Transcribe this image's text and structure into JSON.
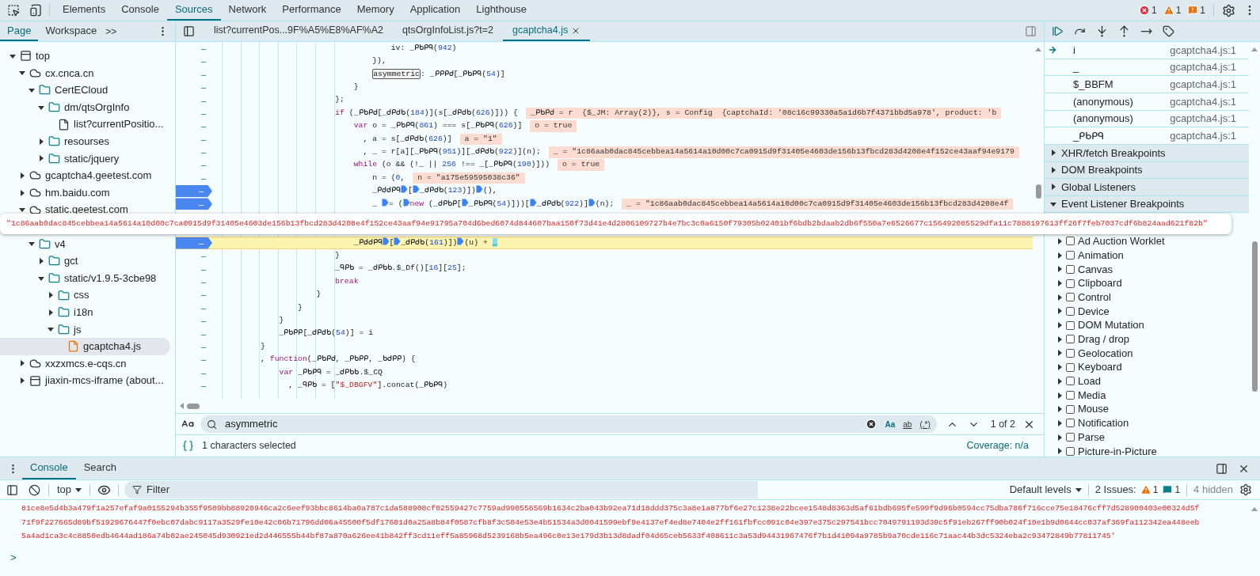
{
  "main_tabs": [
    {
      "label": "Elements",
      "selected": false
    },
    {
      "label": "Console",
      "selected": false
    },
    {
      "label": "Sources",
      "selected": true
    },
    {
      "label": "Network",
      "selected": false
    },
    {
      "label": "Performance",
      "selected": false
    },
    {
      "label": "Memory",
      "selected": false
    },
    {
      "label": "Application",
      "selected": false
    },
    {
      "label": "Lighthouse",
      "selected": false
    }
  ],
  "counters": [
    {
      "kind": "error",
      "count": "1"
    },
    {
      "kind": "warning",
      "count": "1"
    },
    {
      "kind": "issue",
      "count": "1"
    }
  ],
  "navigator": {
    "tabs": [
      {
        "label": "Page",
        "selected": true
      },
      {
        "label": "Workspace",
        "selected": false
      }
    ],
    "more": ">>",
    "tree": [
      {
        "label": "top",
        "kind": "frame",
        "expanded": true,
        "selected": false,
        "children": [
          {
            "label": "cx.cnca.cn",
            "kind": "domain",
            "expanded": true,
            "selected": false,
            "children": [
              {
                "label": "CertECloud",
                "kind": "folder",
                "expanded": true,
                "selected": false,
                "children": [
                  {
                    "label": "dm/qtsOrgInfo",
                    "kind": "folder",
                    "expanded": true,
                    "selected": false,
                    "children": [
                      {
                        "label": "list?currentPositio...",
                        "kind": "file",
                        "selected": false
                      }
                    ]
                  },
                  {
                    "label": "resourses",
                    "kind": "folder",
                    "expanded": false,
                    "selected": false
                  },
                  {
                    "label": "static/jquery",
                    "kind": "folder",
                    "expanded": false,
                    "selected": false
                  }
                ]
              }
            ]
          },
          {
            "label": "gcaptcha4.geetest.com",
            "kind": "domain",
            "expanded": false,
            "selected": false
          },
          {
            "label": "hm.baidu.com",
            "kind": "domain",
            "expanded": false,
            "selected": false
          },
          {
            "label": "static.geetest.com",
            "kind": "domain",
            "expanded": true,
            "selected": false,
            "children": [
              {
                "kind": "covered"
              },
              {
                "label": "v4",
                "kind": "folder",
                "expanded": true,
                "selected": false,
                "children": [
                  {
                    "label": "gct",
                    "kind": "folder",
                    "expanded": false,
                    "selected": false
                  },
                  {
                    "label": "static/v1.9.5-3cbe98",
                    "kind": "folder",
                    "expanded": true,
                    "selected": false,
                    "children": [
                      {
                        "label": "css",
                        "kind": "folder",
                        "expanded": false,
                        "selected": false
                      },
                      {
                        "label": "i18n",
                        "kind": "folder",
                        "expanded": false,
                        "selected": false
                      },
                      {
                        "label": "js",
                        "kind": "folder",
                        "expanded": true,
                        "selected": false,
                        "children": [
                          {
                            "label": "gcaptcha4.js",
                            "kind": "script",
                            "selected": true
                          }
                        ]
                      }
                    ]
                  }
                ]
              }
            ]
          },
          {
            "label": "xxzxmcs.e-cqs.cn",
            "kind": "domain",
            "expanded": false,
            "selected": false
          },
          {
            "label": "jiaxin-mcs-iframe (about...",
            "kind": "frame",
            "expanded": false,
            "selected": false
          }
        ]
      }
    ]
  },
  "editor_tabs": [
    {
      "label": "list?currentPos...9F%A5%E8%AF%A2",
      "selected": false
    },
    {
      "label": "qtsOrgInfoList.js?t=2",
      "selected": false
    },
    {
      "label": "gcaptcha4.js",
      "selected": true
    }
  ],
  "code_lines": [
    {
      "gutter": "–",
      "breakpoint": false,
      "current": false,
      "tokens": [
        {
          "kind": "p",
          "text": "                                    iv: _ᑭᑲᑭᑫ("
        },
        {
          "kind": "n",
          "text": "942"
        },
        {
          "kind": "p",
          "text": ")"
        }
      ]
    },
    {
      "gutter": "–",
      "breakpoint": false,
      "current": false,
      "tokens": [
        {
          "kind": "p",
          "text": "                                }),"
        }
      ]
    },
    {
      "gutter": "–",
      "breakpoint": false,
      "current": false,
      "tokens": [
        {
          "kind": "m",
          "text": "                                asymmetric"
        },
        {
          "kind": "p",
          "text": ": _ᑭᑭᑭᑯ[_ᑭᑲᑭᑫ("
        },
        {
          "kind": "n",
          "text": "54"
        },
        {
          "kind": "p",
          "text": ")]"
        }
      ]
    },
    {
      "gutter": "–",
      "breakpoint": false,
      "current": false,
      "tokens": [
        {
          "kind": "p",
          "text": "                            }"
        }
      ]
    },
    {
      "gutter": "–",
      "breakpoint": false,
      "current": false,
      "tokens": [
        {
          "kind": "p",
          "text": "                        };"
        }
      ]
    },
    {
      "gutter": "–",
      "breakpoint": false,
      "current": false,
      "tokens": [
        {
          "kind": "k",
          "text": "                        if"
        },
        {
          "kind": "p",
          "text": " (_ᑭᑲᑭᑯ[_ᑯᑭᑯᑲ("
        },
        {
          "kind": "n",
          "text": "184"
        },
        {
          "kind": "p",
          "text": ")](s[_ᑯᑭᑯᑲ("
        },
        {
          "kind": "n",
          "text": "626"
        },
        {
          "kind": "p",
          "text": ")])) {"
        }
      ],
      "value": "_ᑭᑲᑭᑯ = r  {$_JM: Array(2)}, s = Config  {captchaId: '08c16c99330a5a1d6b7f4371bbd5a978', product: 'b"
    },
    {
      "gutter": "–",
      "breakpoint": false,
      "current": false,
      "tokens": [
        {
          "kind": "k",
          "text": "                            var"
        },
        {
          "kind": "p",
          "text": " o = _ᑭᑲᑭᑫ("
        },
        {
          "kind": "n",
          "text": "861"
        },
        {
          "kind": "p",
          "text": ") === s[_ᑭᑲᑭᑫ("
        },
        {
          "kind": "n",
          "text": "626"
        },
        {
          "kind": "p",
          "text": ")]"
        }
      ],
      "value": "o = true"
    },
    {
      "gutter": "–",
      "breakpoint": false,
      "current": false,
      "tokens": [
        {
          "kind": "p",
          "text": "                              , a = s[_ᑯᑭᑯᑲ("
        },
        {
          "kind": "n",
          "text": "626"
        },
        {
          "kind": "p",
          "text": ")]"
        }
      ],
      "value": "a = \"1\""
    },
    {
      "gutter": "–",
      "breakpoint": false,
      "current": false,
      "tokens": [
        {
          "kind": "p",
          "text": "                              , _ = r[a][_ᑭᑲᑭᑫ("
        },
        {
          "kind": "n",
          "text": "951"
        },
        {
          "kind": "p",
          "text": ")][_ᑯᑭᑯᑲ("
        },
        {
          "kind": "n",
          "text": "922"
        },
        {
          "kind": "p",
          "text": ")](n);"
        }
      ],
      "value": "_ = \"1c86aab0dac845cebbea14a5614a10d00c7ca0915d9f31405e4603de156b13fbcd283d4208e4f152ce43aaf94e9179"
    },
    {
      "gutter": "–",
      "breakpoint": false,
      "current": false,
      "tokens": [
        {
          "kind": "k",
          "text": "                            while"
        },
        {
          "kind": "p",
          "text": " (o && (!_ || "
        },
        {
          "kind": "n",
          "text": "256"
        },
        {
          "kind": "p",
          "text": " !== _[_ᑭᑲᑭᑫ("
        },
        {
          "kind": "n",
          "text": "190"
        },
        {
          "kind": "p",
          "text": ")]))"
        }
      ],
      "value": "o = true"
    },
    {
      "gutter": "–",
      "breakpoint": false,
      "current": false,
      "tokens": [
        {
          "kind": "p",
          "text": "                                n = ("
        },
        {
          "kind": "n",
          "text": "0"
        },
        {
          "kind": "p",
          "text": ","
        }
      ],
      "value": "n = \"a175e59595038c36\""
    },
    {
      "gutter": "–",
      "breakpoint": true,
      "current": false,
      "tokens": [
        {
          "kind": "p",
          "text": "                                _ᑭᑯᑯᑭᑫ"
        },
        {
          "kind": "b"
        },
        {
          "kind": "p",
          "text": "["
        },
        {
          "kind": "b"
        },
        {
          "kind": "p",
          "text": "_ᑯᑭᑯᑲ("
        },
        {
          "kind": "n",
          "text": "123"
        },
        {
          "kind": "p",
          "text": ")])"
        },
        {
          "kind": "b"
        },
        {
          "kind": "p",
          "text": "(),"
        }
      ]
    },
    {
      "gutter": "–",
      "breakpoint": true,
      "current": false,
      "tokens": [
        {
          "kind": "p",
          "text": "                                _ "
        },
        {
          "kind": "b"
        },
        {
          "kind": "p",
          "text": "= ("
        },
        {
          "kind": "b"
        },
        {
          "kind": "k",
          "text": "new"
        },
        {
          "kind": "p",
          "text": " (_ᑯᑭᑲᑭ["
        },
        {
          "kind": "b"
        },
        {
          "kind": "p",
          "text": "_ᑭᑲᑭᑫ("
        },
        {
          "kind": "n",
          "text": "54"
        },
        {
          "kind": "p",
          "text": ")]))["
        },
        {
          "kind": "b"
        },
        {
          "kind": "p",
          "text": "_ᑯᑭᑯᑲ("
        },
        {
          "kind": "n",
          "text": "922"
        },
        {
          "kind": "p",
          "text": ")]"
        },
        {
          "kind": "b"
        },
        {
          "kind": "p",
          "text": "(n);"
        }
      ],
      "value": "_ = \"1c86aab0dac845cebbea14a5614a10d00c7ca0915d9f31405e4603de156b13fbcd283d4208e4f"
    },
    {
      "kind": "covered"
    },
    {
      "kind": "covered"
    },
    {
      "gutter": "–",
      "breakpoint": true,
      "current": true,
      "tokens": [
        {
          "kind": "p",
          "text": "                            _ᑭᑯᑯᑭᑫ"
        },
        {
          "kind": "b"
        },
        {
          "kind": "p",
          "text": "["
        },
        {
          "kind": "b"
        },
        {
          "kind": "p",
          "text": "_ᑯᑭᑯᑲ("
        },
        {
          "kind": "n",
          "text": "161"
        },
        {
          "kind": "p",
          "text": ")])"
        },
        {
          "kind": "b"
        },
        {
          "kind": "p",
          "text": "(u) + "
        },
        {
          "kind": "c",
          "text": "_"
        }
      ]
    },
    {
      "gutter": "–",
      "breakpoint": false,
      "current": false,
      "tokens": [
        {
          "kind": "p",
          "text": "                        }"
        }
      ]
    },
    {
      "gutter": "–",
      "breakpoint": false,
      "current": false,
      "tokens": [
        {
          "kind": "p",
          "text": "                        _ᑫᑭᑲ = _ᑯᑭᑲᑲ.$_Df()["
        },
        {
          "kind": "n",
          "text": "16"
        },
        {
          "kind": "p",
          "text": "]["
        },
        {
          "kind": "n",
          "text": "25"
        },
        {
          "kind": "p",
          "text": "];"
        }
      ]
    },
    {
      "gutter": "–",
      "breakpoint": false,
      "current": false,
      "tokens": [
        {
          "kind": "k",
          "text": "                        break"
        }
      ]
    },
    {
      "gutter": "–",
      "breakpoint": false,
      "current": false,
      "tokens": [
        {
          "kind": "p",
          "text": "                    }"
        }
      ]
    },
    {
      "gutter": "–",
      "breakpoint": false,
      "current": false,
      "tokens": [
        {
          "kind": "p",
          "text": "                }"
        }
      ]
    },
    {
      "gutter": "–",
      "breakpoint": false,
      "current": false,
      "tokens": [
        {
          "kind": "p",
          "text": "            }"
        }
      ]
    },
    {
      "gutter": "–",
      "breakpoint": false,
      "current": false,
      "tokens": [
        {
          "kind": "p",
          "text": "            _ᑭᑲᑭᑭ[_ᑯᑭᑯᑲ("
        },
        {
          "kind": "n",
          "text": "54"
        },
        {
          "kind": "p",
          "text": ")] = i"
        }
      ]
    },
    {
      "gutter": "–",
      "breakpoint": false,
      "current": false,
      "tokens": [
        {
          "kind": "p",
          "text": "        }"
        }
      ]
    },
    {
      "gutter": "–",
      "breakpoint": false,
      "current": false,
      "tokens": [
        {
          "kind": "p",
          "text": "        , "
        },
        {
          "kind": "k",
          "text": "function"
        },
        {
          "kind": "p",
          "text": "(_ᑭᑲᑭᑯ, _ᑭᑲᑭᑭ, _ᑲᑯᑭᑭ) {"
        }
      ]
    },
    {
      "gutter": "–",
      "breakpoint": false,
      "current": false,
      "tokens": [
        {
          "kind": "k",
          "text": "            var"
        },
        {
          "kind": "p",
          "text": " _ᑭᑲᑭᑫ = _ᑯᑭᑲᑲ.$_CQ"
        }
      ]
    },
    {
      "gutter": "–",
      "breakpoint": false,
      "current": false,
      "tokens": [
        {
          "kind": "p",
          "text": "              , _ᑫᑭᑲ = ["
        },
        {
          "kind": "s",
          "text": "\"$_DBGFV\""
        },
        {
          "kind": "p",
          "text": "].concat(_ᑭᑲᑭᑫ)"
        }
      ]
    }
  ],
  "tooltip": "\"1c86aab0dac845cebbea14a5614a10d00c7ca0915d9f31405e4603de156b13fbcd283d4208e4f152ce43aaf94e91795a704d6bed6074d844607baa150f73d41e4d2806109727b4e7bc3c0a6150f79305b02401bf6bdb2bdaab2db6f550a7e6526677c156492085529dfa11c7888197613ff26f7feb7037cdf6b824aad621f82b\"",
  "search": {
    "value": "asymmetric",
    "options": [
      "Aa",
      "ab",
      "(.*)"
    ],
    "count": "1 of 2"
  },
  "status": {
    "selection": "1 characters selected",
    "coverage": "Coverage: n/a"
  },
  "call_stack": [
    {
      "name": "i",
      "location": "gcaptcha4.js:1",
      "current": true
    },
    {
      "name": "_",
      "location": "gcaptcha4.js:1",
      "current": false
    },
    {
      "name": "$_BBFM",
      "location": "gcaptcha4.js:1",
      "current": false
    },
    {
      "name": "(anonymous)",
      "location": "gcaptcha4.js:1",
      "current": false
    },
    {
      "name": "(anonymous)",
      "location": "gcaptcha4.js:1",
      "current": false
    },
    {
      "name": "_ᑭᑲᑭᑫ",
      "location": "gcaptcha4.js:1",
      "current": false
    }
  ],
  "sections": [
    {
      "label": "XHR/fetch Breakpoints",
      "expanded": false
    },
    {
      "label": "DOM Breakpoints",
      "expanded": false
    },
    {
      "label": "Global Listeners",
      "expanded": false
    },
    {
      "label": "Event Listener Breakpoints",
      "expanded": true
    }
  ],
  "event_categories": [
    {
      "kind": "covered"
    },
    {
      "label": "Ad Auction Worklet",
      "checked": false
    },
    {
      "label": "Animation",
      "checked": false
    },
    {
      "label": "Canvas",
      "checked": false
    },
    {
      "label": "Clipboard",
      "checked": false
    },
    {
      "label": "Control",
      "checked": false
    },
    {
      "label": "Device",
      "checked": false
    },
    {
      "label": "DOM Mutation",
      "checked": false
    },
    {
      "label": "Drag / drop",
      "checked": false
    },
    {
      "label": "Geolocation",
      "checked": false
    },
    {
      "label": "Keyboard",
      "checked": false
    },
    {
      "label": "Load",
      "checked": false
    },
    {
      "label": "Media",
      "checked": false
    },
    {
      "label": "Mouse",
      "checked": false
    },
    {
      "label": "Notification",
      "checked": false
    },
    {
      "label": "Parse",
      "checked": false
    },
    {
      "label": "Picture-in-Picture",
      "checked": false
    }
  ],
  "drawer": {
    "tabs": [
      {
        "label": "Console",
        "selected": true
      },
      {
        "label": "Search",
        "selected": false
      }
    ],
    "context": "top",
    "filter_placeholder": "Filter",
    "levels": "Default levels",
    "issues_label": "2 Issues:",
    "issue_counts": [
      {
        "kind": "warning",
        "count": "1"
      },
      {
        "kind": "info",
        "count": "1"
      }
    ],
    "hidden": "4 hidden",
    "output": [
      "81ce8e5d4b3a479f1a257efaf9a0155294b355f9509bb88920946ca2c6eef93bbc8614ba0a787c1da588908cf02559427c7759ad990556569b1634c2ba043b92ea71d18ddd375c3a8e1a877bf6e27c1238e22bcee1548d8363d5af61bdb695fe599f9d96b0594cc75dba786f716cce75e18476cff7d528900403e00324d5f",
      "71f9f227665d89bf51929676447f0ebc07dabc9117a3529fe10e42c06b71796dd06a45500f5df17601d0a25a8b84f0587cfb8f3c504e53e4b51534a3d0041599ebf9e4137ef4ed8e7404e2ff161fbfcc091c04e397e375c297541bcc7049791193d39c5f91eb267ff90b024f10e1b9d0644cc037af369fa112342ea448eeb",
      "5a4ad1ca3c4c8850edb4644ad186a74b02ae245045d930921ed2d446555b44bf87a870a626ee41b842ff3cd11eff5a85968d5239168b5ea496c0e13e179d3b13d8dadf04d65ceb5633f408611c3a53d94431967476f7b1d41094a9785b9a70cde116c71aac44b3dc5324eba2c93472849b77811745'"
    ],
    "prompt": ">"
  }
}
